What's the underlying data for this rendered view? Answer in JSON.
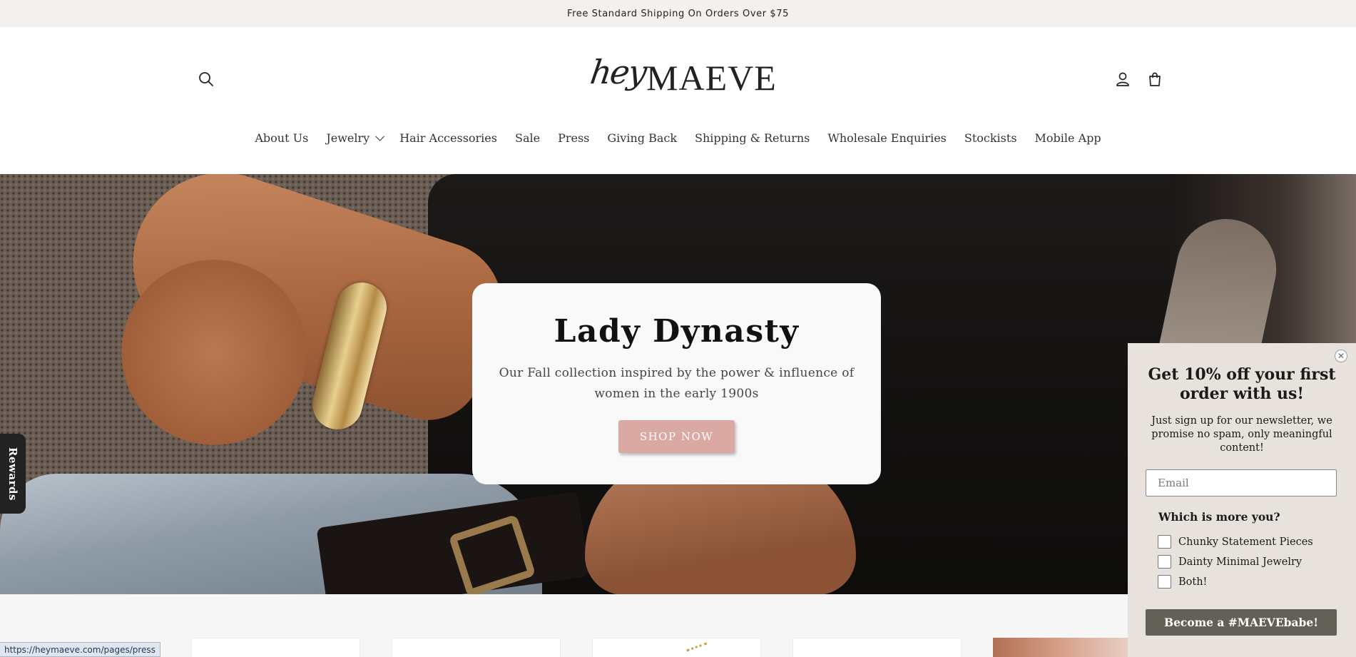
{
  "announcement": {
    "text": "Free Standard Shipping On Orders Over $75"
  },
  "header": {
    "logo_script": "hey",
    "logo_brand": "MAEVE",
    "icons": [
      "search-icon",
      "account-icon",
      "cart-icon"
    ]
  },
  "nav": {
    "items": [
      {
        "label": "About Us"
      },
      {
        "label": "Jewelry",
        "has_dropdown": true
      },
      {
        "label": "Hair Accessories"
      },
      {
        "label": "Sale"
      },
      {
        "label": "Press"
      },
      {
        "label": "Giving Back"
      },
      {
        "label": "Shipping & Returns"
      },
      {
        "label": "Wholesale Enquiries"
      },
      {
        "label": "Stockists"
      },
      {
        "label": "Mobile App"
      }
    ]
  },
  "hero": {
    "title": "Lady Dynasty",
    "subtitle": "Our Fall collection inspired by the power & influence of women in the early 1900s",
    "button_label": "SHOP NOW",
    "button_color": "#dba9a4"
  },
  "rewards": {
    "label": "Rewards"
  },
  "status_url": "https://heymaeve.com/pages/press",
  "popup": {
    "title": "Get 10% off your first order with us!",
    "description": "Just sign up for our newsletter, we promise no spam, only meaningful content!",
    "email_placeholder": "Email",
    "question": "Which is more you?",
    "options": [
      {
        "label": "Chunky Statement Pieces",
        "checked": false
      },
      {
        "label": "Dainty Minimal Jewelry",
        "checked": false
      },
      {
        "label": "Both!",
        "checked": false
      }
    ],
    "submit_label": "Become a #MAEVEbabe!",
    "close_symbol": "✕",
    "background_color": "#e7e2dc",
    "button_color": "#636058"
  }
}
